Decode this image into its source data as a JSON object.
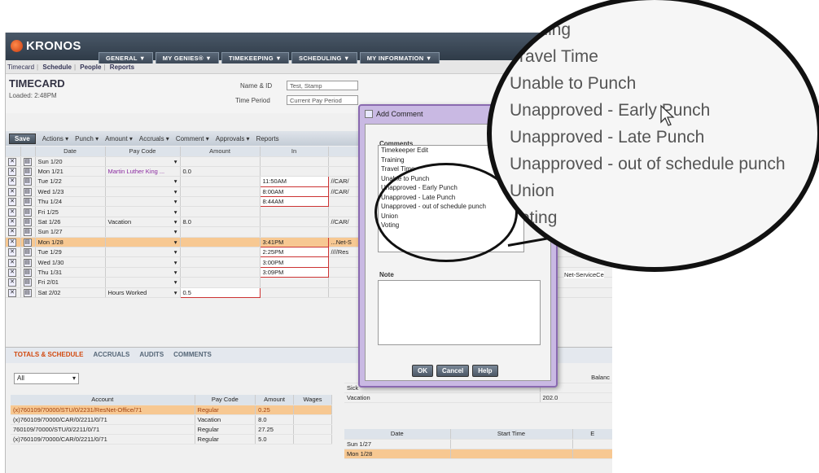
{
  "app": {
    "logo": "KRONOS",
    "menus": [
      "GENERAL ▼",
      "MY GENIES® ▼",
      "TIMEKEEPING ▼",
      "SCHEDULING ▼",
      "MY INFORMATION ▼"
    ],
    "nav_tabs": [
      "Timecard",
      "Schedule",
      "People",
      "Reports"
    ]
  },
  "header": {
    "title": "TIMECARD",
    "loaded": "Loaded: 2:48PM",
    "name_label": "Name & ID",
    "name_value": "Test, Stamp",
    "period_label": "Time Period",
    "period_value": "Current Pay Period"
  },
  "toolbar": {
    "save": "Save",
    "items": [
      "Actions ▾",
      "Punch ▾",
      "Amount ▾",
      "Accruals ▾",
      "Comment ▾",
      "Approvals ▾",
      "Reports"
    ]
  },
  "grid": {
    "headers": [
      "Date",
      "Pay Code",
      "Amount",
      "In",
      ""
    ],
    "rows": [
      {
        "date": "Sun 1/20",
        "paycode": "",
        "amount": "",
        "in": "",
        "xfer": ""
      },
      {
        "date": "Mon 1/21",
        "paycode": "Martin Luther King ...",
        "amount": "0.0",
        "in": "",
        "xfer": ""
      },
      {
        "date": "Tue 1/22",
        "paycode": "",
        "amount": "",
        "in": "11:50AM",
        "xfer": "//CAR/"
      },
      {
        "date": "Wed 1/23",
        "paycode": "",
        "amount": "",
        "in": "8:00AM",
        "xfer": "//CAR/"
      },
      {
        "date": "Thu 1/24",
        "paycode": "",
        "amount": "",
        "in": "8:44AM",
        "xfer": ""
      },
      {
        "date": "Fri 1/25",
        "paycode": "",
        "amount": "",
        "in": "",
        "xfer": ""
      },
      {
        "date": "Sat 1/26",
        "paycode": "Vacation",
        "amount": "8.0",
        "in": "",
        "xfer": "//CAR/"
      },
      {
        "date": "Sun 1/27",
        "paycode": "",
        "amount": "",
        "in": "",
        "xfer": ""
      },
      {
        "date": "Mon 1/28",
        "paycode": "",
        "amount": "",
        "in": "3:41PM",
        "xfer": "...Net-S"
      },
      {
        "date": "Tue 1/29",
        "paycode": "",
        "amount": "",
        "in": "2:25PM",
        "xfer": "////Res"
      },
      {
        "date": "Wed 1/30",
        "paycode": "",
        "amount": "",
        "in": "3:00PM",
        "xfer": ""
      },
      {
        "date": "Thu 1/31",
        "paycode": "",
        "amount": "",
        "in": "3:09PM",
        "xfer": ""
      },
      {
        "date": "Fri 2/01",
        "paycode": "",
        "amount": "",
        "in": "",
        "xfer": ""
      },
      {
        "date": "Sat 2/02",
        "paycode": "Hours Worked",
        "amount": "0.5",
        "in": "",
        "xfer": ""
      }
    ],
    "right_text": "Net-ServiceCe"
  },
  "bottom": {
    "tabs": [
      "TOTALS & SCHEDULE",
      "ACCRUALS",
      "AUDITS",
      "COMMENTS"
    ],
    "filter": "All",
    "acct_headers": [
      "Account",
      "Pay Code",
      "Amount",
      "Wages"
    ],
    "acct_rows": [
      [
        "(x)760109/70000/STU/0/2231/ResNet-Office/71",
        "Regular",
        "0.25",
        ""
      ],
      [
        "(x)760109/70000/CAR/0/2211/0/71",
        "Vacation",
        "8.0",
        ""
      ],
      [
        "760109/70000/STU/0/2211/0/71",
        "Regular",
        "27.25",
        ""
      ],
      [
        "(x)760109/70000/CAR/0/2211/0/71",
        "Regular",
        "5.0",
        ""
      ]
    ],
    "accrual_rows": [
      [
        "Sick",
        ""
      ],
      [
        "Vacation",
        "202.0"
      ]
    ],
    "balance_label": "Balanc",
    "sched_headers": [
      "Date",
      "Start Time",
      "E"
    ],
    "sched_rows": [
      "Sun 1/27",
      "Mon 1/28"
    ]
  },
  "dialog": {
    "title": "Add Comment",
    "comments_label": "Comments",
    "options": [
      "Timekeeper Edit",
      "Training",
      "Travel Time",
      "Unable to Punch",
      "Unapproved - Early Punch",
      "Unapproved - Late Punch",
      "Unapproved - out of schedule punch",
      "Union",
      "Voting"
    ],
    "note_label": "Note",
    "ok": "OK",
    "cancel": "Cancel",
    "help": "Help"
  },
  "zoom": {
    "items": [
      "Training",
      "Travel Time",
      "Unable to Punch",
      "Unapproved - Early Punch",
      "Unapproved - Late Punch",
      "Unapproved - out of schedule punch",
      "Union",
      "Voting"
    ]
  }
}
